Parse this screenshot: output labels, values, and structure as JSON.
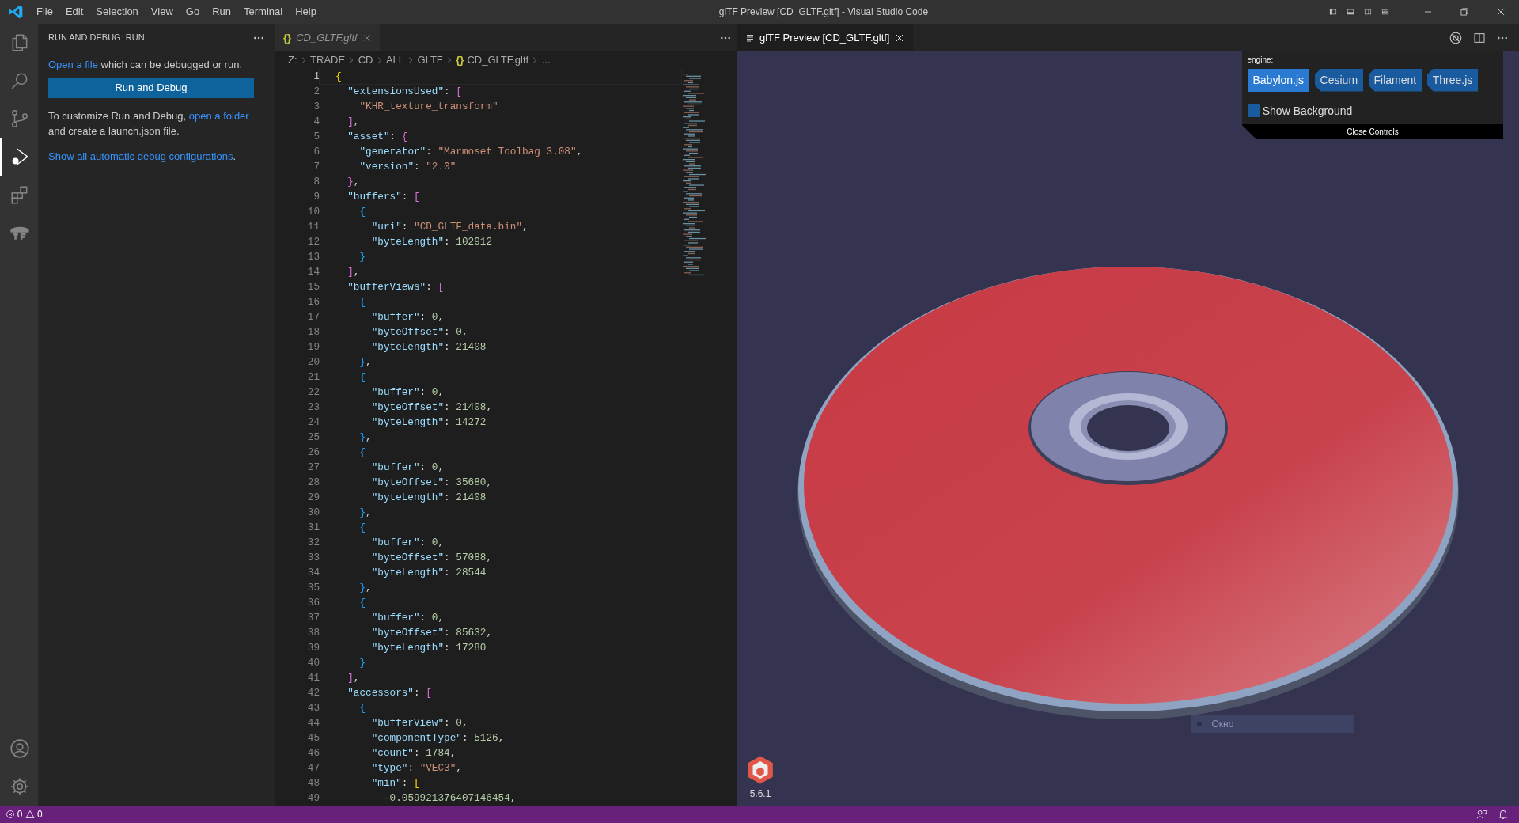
{
  "window": {
    "title": "glTF Preview [CD_GLTF.gltf] - Visual Studio Code"
  },
  "menu": [
    "File",
    "Edit",
    "Selection",
    "View",
    "Go",
    "Run",
    "Terminal",
    "Help"
  ],
  "activity_bar": [
    {
      "kind": "explorer",
      "selected": false
    },
    {
      "kind": "search",
      "selected": false
    },
    {
      "kind": "source-control",
      "selected": false
    },
    {
      "kind": "run-debug",
      "selected": true
    },
    {
      "kind": "extensions",
      "selected": false
    },
    {
      "kind": "tf",
      "selected": false
    }
  ],
  "sidebar": {
    "title": "RUN AND DEBUG: RUN",
    "intro_link": "Open a file",
    "intro_text": " which can be debugged or run.",
    "button": "Run and Debug",
    "customize_text": "To customize Run and Debug, ",
    "customize_link": "open a folder",
    "customize_rest": "and create a launch.json file.",
    "show_all_link": "Show all automatic debug configurations",
    "show_all_end": "."
  },
  "editor": {
    "tab": {
      "label": "CD_GLTF.gltf",
      "icon_text": "{}",
      "selected": false
    },
    "breadcrumbs": [
      "Z:",
      "TRADE",
      "CD",
      "ALL",
      "GLTF",
      "CD_GLTF.gltf",
      "..."
    ],
    "lines": [
      {
        "number": "1",
        "text": "{",
        "current": true
      },
      {
        "number": "2",
        "text": "  \"extensionsUsed\": [",
        "current": false
      },
      {
        "number": "3",
        "text": "    \"KHR_texture_transform\"",
        "current": false
      },
      {
        "number": "4",
        "text": "  ],",
        "current": false
      },
      {
        "number": "5",
        "text": "  \"asset\": {",
        "current": false
      },
      {
        "number": "6",
        "text": "    \"generator\": \"Marmoset Toolbag 3.08\",",
        "current": false
      },
      {
        "number": "7",
        "text": "    \"version\": \"2.0\"",
        "current": false
      },
      {
        "number": "8",
        "text": "  },",
        "current": false
      },
      {
        "number": "9",
        "text": "  \"buffers\": [",
        "current": false
      },
      {
        "number": "10",
        "text": "    {",
        "current": false
      },
      {
        "number": "11",
        "text": "      \"uri\": \"CD_GLTF_data.bin\",",
        "current": false
      },
      {
        "number": "12",
        "text": "      \"byteLength\": 102912",
        "current": false
      },
      {
        "number": "13",
        "text": "    }",
        "current": false
      },
      {
        "number": "14",
        "text": "  ],",
        "current": false
      },
      {
        "number": "15",
        "text": "  \"bufferViews\": [",
        "current": false
      },
      {
        "number": "16",
        "text": "    {",
        "current": false
      },
      {
        "number": "17",
        "text": "      \"buffer\": 0,",
        "current": false
      },
      {
        "number": "18",
        "text": "      \"byteOffset\": 0,",
        "current": false
      },
      {
        "number": "19",
        "text": "      \"byteLength\": 21408",
        "current": false
      },
      {
        "number": "20",
        "text": "    },",
        "current": false
      },
      {
        "number": "21",
        "text": "    {",
        "current": false
      },
      {
        "number": "22",
        "text": "      \"buffer\": 0,",
        "current": false
      },
      {
        "number": "23",
        "text": "      \"byteOffset\": 21408,",
        "current": false
      },
      {
        "number": "24",
        "text": "      \"byteLength\": 14272",
        "current": false
      },
      {
        "number": "25",
        "text": "    },",
        "current": false
      },
      {
        "number": "26",
        "text": "    {",
        "current": false
      },
      {
        "number": "27",
        "text": "      \"buffer\": 0,",
        "current": false
      },
      {
        "number": "28",
        "text": "      \"byteOffset\": 35680,",
        "current": false
      },
      {
        "number": "29",
        "text": "      \"byteLength\": 21408",
        "current": false
      },
      {
        "number": "30",
        "text": "    },",
        "current": false
      },
      {
        "number": "31",
        "text": "    {",
        "current": false
      },
      {
        "number": "32",
        "text": "      \"buffer\": 0,",
        "current": false
      },
      {
        "number": "33",
        "text": "      \"byteOffset\": 57088,",
        "current": false
      },
      {
        "number": "34",
        "text": "      \"byteLength\": 28544",
        "current": false
      },
      {
        "number": "35",
        "text": "    },",
        "current": false
      },
      {
        "number": "36",
        "text": "    {",
        "current": false
      },
      {
        "number": "37",
        "text": "      \"buffer\": 0,",
        "current": false
      },
      {
        "number": "38",
        "text": "      \"byteOffset\": 85632,",
        "current": false
      },
      {
        "number": "39",
        "text": "      \"byteLength\": 17280",
        "current": false
      },
      {
        "number": "40",
        "text": "    }",
        "current": false
      },
      {
        "number": "41",
        "text": "  ],",
        "current": false
      },
      {
        "number": "42",
        "text": "  \"accessors\": [",
        "current": false
      },
      {
        "number": "43",
        "text": "    {",
        "current": false
      },
      {
        "number": "44",
        "text": "      \"bufferView\": 0,",
        "current": false
      },
      {
        "number": "45",
        "text": "      \"componentType\": 5126,",
        "current": false
      },
      {
        "number": "46",
        "text": "      \"count\": 1784,",
        "current": false
      },
      {
        "number": "47",
        "text": "      \"type\": \"VEC3\",",
        "current": false
      },
      {
        "number": "48",
        "text": "      \"min\": [",
        "current": false
      },
      {
        "number": "49",
        "text": "        -0.059921376407146454,",
        "current": false
      }
    ]
  },
  "preview": {
    "tab": {
      "label": "glTF Preview [CD_GLTF.gltf]",
      "selected": true
    },
    "controls": {
      "engine_label": "engine:",
      "engines": [
        {
          "label": "Babylon.js",
          "selected": true
        },
        {
          "label": "Cesium",
          "selected": false
        },
        {
          "label": "Filament",
          "selected": false
        },
        {
          "label": "Three.js",
          "selected": false
        }
      ],
      "show_background": {
        "label": "Show Background",
        "checked": false
      },
      "close": "Close Controls"
    },
    "overlay_label": "Окно",
    "engine_version": "5.6.1"
  },
  "status_bar": {
    "errors": "0",
    "warnings": "0"
  }
}
